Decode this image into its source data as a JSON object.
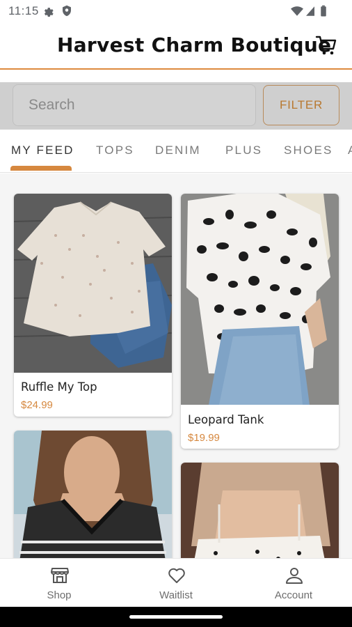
{
  "status_bar": {
    "time": "11:15"
  },
  "header": {
    "title": "Harvest Charm Boutique"
  },
  "search": {
    "placeholder": "Search",
    "filter_label": "FILTER"
  },
  "tabs": [
    {
      "label": "MY FEED",
      "active": true
    },
    {
      "label": "TOPS",
      "active": false
    },
    {
      "label": "DENIM",
      "active": false
    },
    {
      "label": "PLUS",
      "active": false
    },
    {
      "label": "SHOES",
      "active": false
    },
    {
      "label": "A",
      "active": false
    }
  ],
  "products": [
    {
      "name": "Ruffle My Top",
      "price": "$24.99"
    },
    {
      "name": "Leopard Tank",
      "price": "$19.99"
    },
    {
      "name": "",
      "price": ""
    },
    {
      "name": "",
      "price": ""
    }
  ],
  "bottom_nav": [
    {
      "label": "Shop",
      "icon": "shop-icon"
    },
    {
      "label": "Waitlist",
      "icon": "heart-icon"
    },
    {
      "label": "Account",
      "icon": "account-icon"
    }
  ],
  "colors": {
    "accent": "#d6883f",
    "header_rule": "#dd8a3d",
    "search_band": "#cfcfcf"
  }
}
